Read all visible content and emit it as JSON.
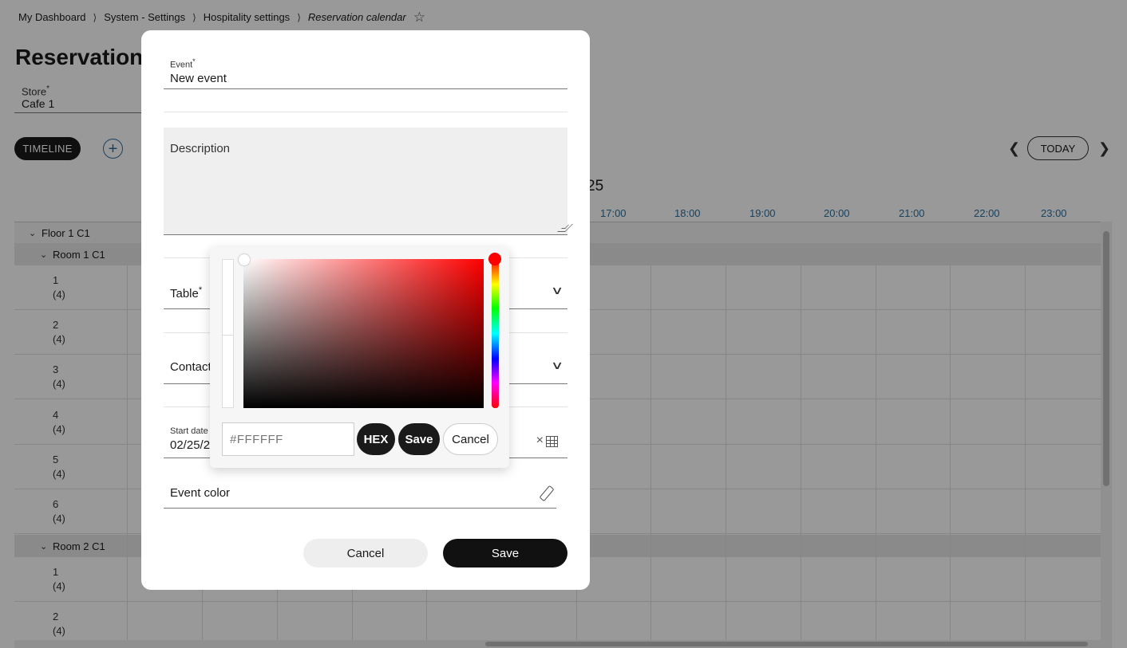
{
  "breadcrumb": {
    "items": [
      "My Dashboard",
      "System - Settings",
      "Hospitality settings",
      "Reservation calendar"
    ],
    "separator": "⟩",
    "favorite_icon": "star-outline-icon"
  },
  "page": {
    "title": "Reservation",
    "store_label": "Store",
    "store_required": "*",
    "store_value": "Cafe 1",
    "timeline_label": "TIMELINE",
    "add_icon": "plus-circle-icon",
    "today_label": "TODAY",
    "date_partial": "25",
    "hours": [
      "17:00",
      "18:00",
      "19:00",
      "20:00",
      "21:00",
      "22:00",
      "23:00"
    ]
  },
  "grid": {
    "floor": "Floor 1 C1",
    "room1": "Room 1 C1",
    "room2": "Room 2 C1",
    "room1_tables": [
      {
        "name": "1",
        "cap": "(4)"
      },
      {
        "name": "2",
        "cap": "(4)"
      },
      {
        "name": "3",
        "cap": "(4)"
      },
      {
        "name": "4",
        "cap": "(4)"
      },
      {
        "name": "5",
        "cap": "(4)"
      },
      {
        "name": "6",
        "cap": "(4)"
      }
    ],
    "room2_tables": [
      {
        "name": "1",
        "cap": "(4)"
      },
      {
        "name": "2",
        "cap": "(4)"
      }
    ]
  },
  "modal": {
    "event_label": "Event",
    "event_required": "*",
    "event_value": "New event",
    "description_label": "Description",
    "table_label": "Table",
    "table_required": "*",
    "contact_label": "Contact",
    "start_label": "Start date",
    "start_value": "02/25/2",
    "event_color_label": "Event color",
    "cancel_label": "Cancel",
    "save_label": "Save"
  },
  "color_picker": {
    "hex_placeholder": "#FFFFFF",
    "hex_button": "HEX",
    "save_label": "Save",
    "cancel_label": "Cancel",
    "hue_color": "#FF0000",
    "selected_color": "#FFFFFF"
  }
}
